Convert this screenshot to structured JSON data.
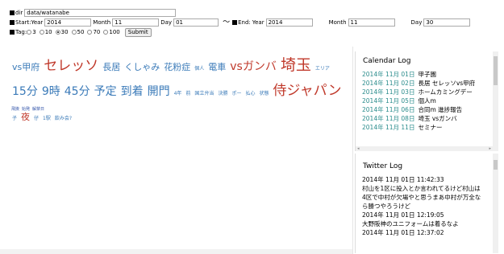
{
  "form": {
    "dir_label": "dir",
    "dir_value": "data/watanabe",
    "start_label": "Start",
    "year_label": "Year",
    "start_year": "2014",
    "month_label": "Month",
    "start_month": "11",
    "day_label": "Day",
    "start_day": "01",
    "tilde": "〜",
    "end_label": "End",
    "end_year": "2014",
    "end_month": "11",
    "end_day": "30",
    "tag_label": "Tag",
    "tag_options": [
      "3",
      "10",
      "30",
      "50",
      "70",
      "100"
    ],
    "tag_selected": "30",
    "submit_label": "Submit"
  },
  "cloud": [
    {
      "text": "vs甲府",
      "size": 11,
      "color": "#3a7ab8"
    },
    {
      "text": "セレッソ",
      "size": 17,
      "color": "#c0392b"
    },
    {
      "text": "長居",
      "size": 11,
      "color": "#3a7ab8"
    },
    {
      "text": "くしゃみ",
      "size": 11,
      "color": "#3a7ab8"
    },
    {
      "text": "花粉症",
      "size": 11,
      "color": "#3a7ab8"
    },
    {
      "text": "個人",
      "size": 6,
      "color": "#3a7ab8"
    },
    {
      "text": "電車",
      "size": 11,
      "color": "#3a7ab8"
    },
    {
      "text": "vsガンバ",
      "size": 14,
      "color": "#c0392b"
    },
    {
      "text": "埼玉",
      "size": 19,
      "color": "#c0392b"
    },
    {
      "text": "エリア",
      "size": 6,
      "color": "#3a7ab8"
    },
    {
      "text": "15分",
      "size": 14,
      "color": "#3a7ab8"
    },
    {
      "text": "9時",
      "size": 14,
      "color": "#3a7ab8"
    },
    {
      "text": "45分",
      "size": 14,
      "color": "#3a7ab8"
    },
    {
      "text": "予定",
      "size": 14,
      "color": "#3a7ab8"
    },
    {
      "text": "到着",
      "size": 14,
      "color": "#3a7ab8"
    },
    {
      "text": "開門",
      "size": 14,
      "color": "#3a7ab8"
    },
    {
      "text": "4年",
      "size": 6,
      "color": "#3a7ab8"
    },
    {
      "text": "前",
      "size": 6,
      "color": "#3a7ab8"
    },
    {
      "text": "国立弁当",
      "size": 6,
      "color": "#3a7ab8"
    },
    {
      "text": "決勝",
      "size": 6,
      "color": "#3a7ab8"
    },
    {
      "text": "ポー",
      "size": 6,
      "color": "#3a7ab8"
    },
    {
      "text": "払心",
      "size": 6,
      "color": "#3a7ab8"
    },
    {
      "text": "状態",
      "size": 6,
      "color": "#3a7ab8"
    },
    {
      "text": "侍ジャパン",
      "size": 17,
      "color": "#c0392b"
    },
    {
      "text": "子",
      "size": 6,
      "color": "#3a7ab8"
    },
    {
      "text": "夜",
      "size": 11,
      "color": "#c0392b"
    },
    {
      "text": "仔",
      "size": 6,
      "color": "#3a7ab8"
    },
    {
      "text": "1駅",
      "size": 6,
      "color": "#3a7ab8"
    },
    {
      "text": "飲み会?",
      "size": 6,
      "color": "#3a7ab8"
    }
  ],
  "tiny_tags": [
    "飛挨",
    "始発",
    "解禁日"
  ],
  "calendar": {
    "title": "Calendar Log",
    "entries": [
      {
        "date": "2014年 11月 01日",
        "text": "甲子園"
      },
      {
        "date": "2014年 11月 02日",
        "text": "長居 セレッソvs甲府"
      },
      {
        "date": "2014年 11月 03日",
        "text": "ホームカミングデー"
      },
      {
        "date": "2014年 11月 05日",
        "text": "個人m"
      },
      {
        "date": "2014年 11月 06日",
        "text": "合同m 進捗報告"
      },
      {
        "date": "2014年 11月 08日",
        "text": "埼玉 vsガンバ"
      },
      {
        "date": "2014年 11月 11日",
        "text": "セミナー"
      }
    ]
  },
  "twitter": {
    "title": "Twitter Log",
    "entries": [
      {
        "date": "2014年 11月 01日 11:42:33",
        "lines": [
          "村山を1区に投入とか言われてるけど村山は",
          "4区で中村が欠場やと思うまあ中村が万全な",
          "ら勝つやろうけど"
        ]
      },
      {
        "date": "2014年 11月 01日 12:19:05",
        "lines": [
          "大野阪神のユニフォームは着るなよ"
        ]
      },
      {
        "date": "2014年 11月 01日 12:37:02",
        "lines": []
      }
    ]
  }
}
